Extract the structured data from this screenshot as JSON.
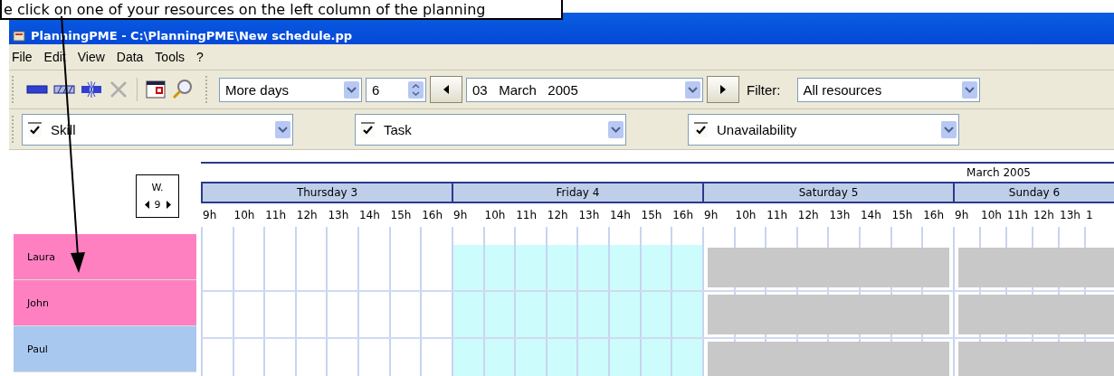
{
  "callout": {
    "text": "e click on one of your resources on the left column of the planning"
  },
  "window": {
    "title": "PlanningPME - C:\\PlanningPME\\New schedule.pp"
  },
  "menu": [
    "File",
    "Edit",
    "View",
    "Data",
    "Tools",
    "?"
  ],
  "toolbar": {
    "tools": [
      {
        "kind": "bar",
        "disabled": false
      },
      {
        "kind": "hatched",
        "disabled": false
      },
      {
        "kind": "split",
        "disabled": false
      },
      {
        "kind": "delete",
        "disabled": true
      },
      {
        "kind": "calendar",
        "disabled": false
      },
      {
        "kind": "zoom",
        "disabled": false
      }
    ],
    "view_mode": "More days",
    "day_count": "6",
    "date": "03   March   2005",
    "filter_label": "Filter:",
    "filter": "All resources"
  },
  "filters": [
    {
      "label": "Skill",
      "checked": true
    },
    {
      "label": "Task",
      "checked": true
    },
    {
      "label": "Unavailability",
      "checked": true
    }
  ],
  "planning": {
    "week_label": "W.",
    "week_number": "9",
    "month": "March 2005",
    "days": [
      {
        "label": "Thursday 3",
        "kind": "normal",
        "hours": [
          "9h",
          "10h",
          "11h",
          "12h",
          "13h",
          "14h",
          "15h",
          "16h"
        ]
      },
      {
        "label": "Friday 4",
        "kind": "current",
        "hours": [
          "9h",
          "10h",
          "11h",
          "12h",
          "13h",
          "14h",
          "15h",
          "16h"
        ]
      },
      {
        "label": "Saturday 5",
        "kind": "closed",
        "hours": [
          "9h",
          "10h",
          "11h",
          "12h",
          "13h",
          "14h",
          "15h",
          "16h"
        ]
      },
      {
        "label": "Sunday 6",
        "kind": "closed",
        "hours": [
          "9h",
          "10h",
          "11h",
          "12h",
          "13h",
          "1"
        ]
      }
    ],
    "resources": [
      {
        "name": "Laura",
        "color": "#ff80c0"
      },
      {
        "name": "John",
        "color": "#ff80c0"
      },
      {
        "name": "Paul",
        "color": "#a8c8f0"
      }
    ]
  }
}
